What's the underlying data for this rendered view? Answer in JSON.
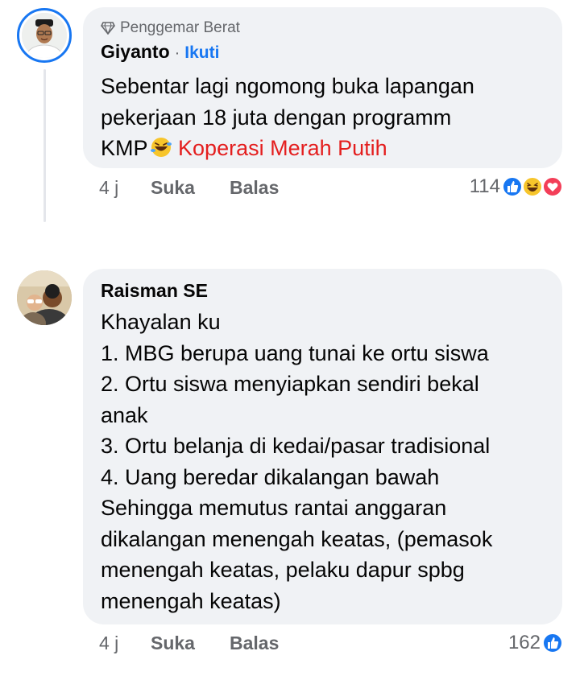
{
  "comments": [
    {
      "badge": "Penggemar Berat",
      "author": "Giyanto",
      "separator": "·",
      "follow_label": "Ikuti",
      "lines": [
        "Sebentar lagi ngomong buka lapangan",
        "pekerjaan 18 juta dengan programm"
      ],
      "last_line_prefix": "KMP",
      "last_line_suffix": "Koperasi Merah Putih",
      "time": "4 j",
      "like_label": "Suka",
      "reply_label": "Balas",
      "reaction_count": "114",
      "reactions": [
        "like-icon",
        "haha-icon",
        "love-icon"
      ]
    },
    {
      "author": "Raisman SE",
      "lines": [
        "Khayalan ku",
        "1. MBG berupa uang tunai ke ortu siswa",
        "2. Ortu siswa menyiapkan sendiri bekal",
        "anak",
        "3. Ortu belanja di kedai/pasar tradisional",
        "4. Uang beredar dikalangan bawah",
        "Sehingga memutus rantai anggaran",
        "dikalangan menengah keatas, (pemasok",
        "menengah keatas, pelaku dapur spbg",
        "menengah keatas)"
      ],
      "time": "4 j",
      "like_label": "Suka",
      "reply_label": "Balas",
      "reaction_count": "162",
      "reactions": [
        "like-icon"
      ]
    }
  ],
  "colors": {
    "accent": "#1877f2",
    "bubble": "#f0f2f5",
    "muted": "#65676b",
    "red_text": "#e41e1e"
  }
}
